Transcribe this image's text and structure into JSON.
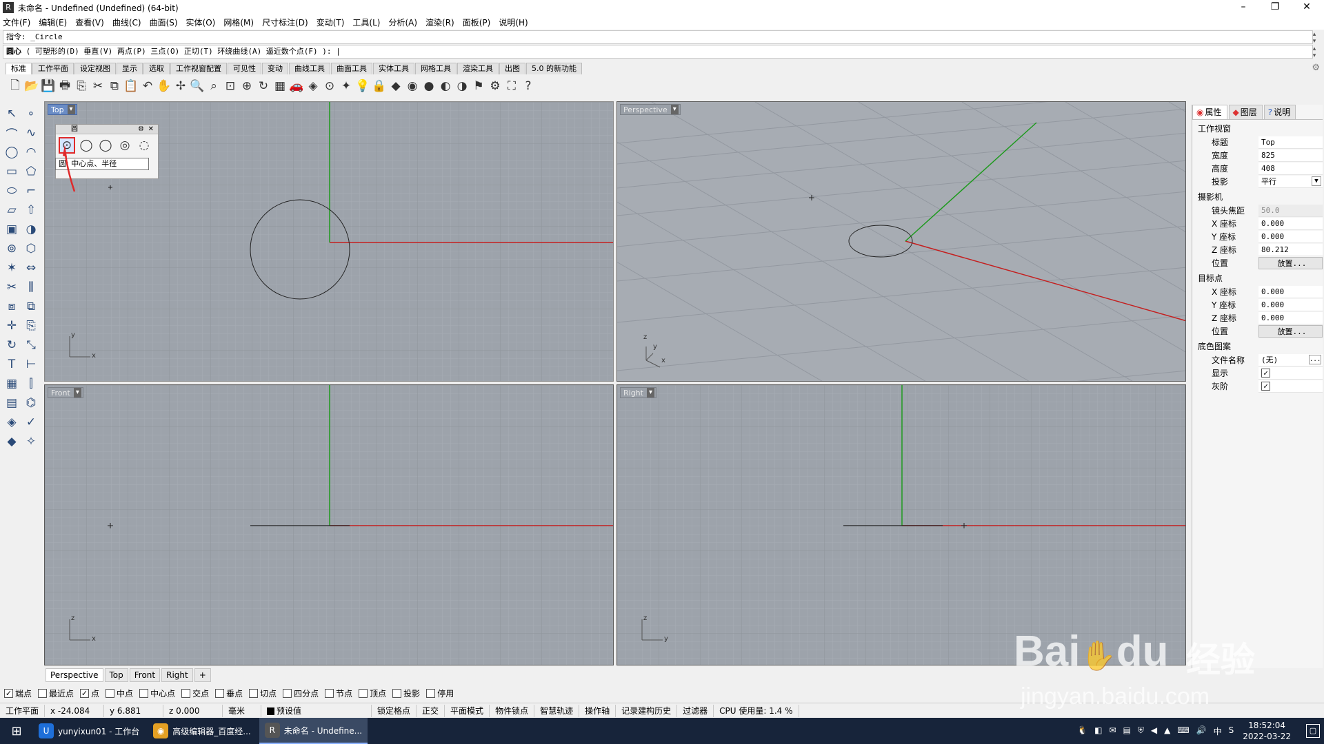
{
  "window": {
    "title": "未命名 - Undefined (Undefined) (64-bit)",
    "app_icon": "rhino-icon",
    "controls": {
      "minimize": "–",
      "maximize": "❐",
      "close": "✕"
    }
  },
  "menu": [
    "文件(F)",
    "编辑(E)",
    "查看(V)",
    "曲线(C)",
    "曲面(S)",
    "实体(O)",
    "网格(M)",
    "尺寸标注(D)",
    "变动(T)",
    "工具(L)",
    "分析(A)",
    "渲染(R)",
    "面板(P)",
    "说明(H)"
  ],
  "command": {
    "history": "指令: _Circle",
    "prompt_label": "圆心",
    "prompt_options": " ( 可塑形的(D)  垂直(V)  两点(P)  三点(O)  正切(T)  环绕曲线(A)  逼近数个点(F) ): |"
  },
  "toolbar_tabs": [
    "标准",
    "工作平面",
    "设定视图",
    "显示",
    "选取",
    "工作视窗配置",
    "可见性",
    "变动",
    "曲线工具",
    "曲面工具",
    "实体工具",
    "网格工具",
    "渲染工具",
    "出图",
    "5.0 的新功能"
  ],
  "toolbar_icons": [
    "new-icon",
    "open-icon",
    "save-icon",
    "print-icon",
    "import-icon",
    "cut-icon",
    "copy-icon",
    "paste-icon",
    "undo-icon",
    "pan-icon",
    "rotate-icon",
    "zoom-icon",
    "zoom-window-icon",
    "zoom-extents-icon",
    "zoom-selected-icon",
    "rotate-view-icon",
    "four-view-icon",
    "car-icon",
    "cplane-icon",
    "grid-snap-icon",
    "lights-icon",
    "bulb-icon",
    "lock-icon",
    "material-icon",
    "color-wheel-icon",
    "sphere-icon",
    "shaded-icon",
    "render-icon",
    "highlight-icon",
    "settings-icon",
    "options-icon",
    "help-icon"
  ],
  "toolbar_glyphs": [
    "🗋",
    "📂",
    "💾",
    "🖶",
    "⎘",
    "✂",
    "⧉",
    "📋",
    "↶",
    "✋",
    "✢",
    "🔍",
    "⌕",
    "⊡",
    "⊕",
    "↻",
    "▦",
    "🚗",
    "◈",
    "⊙",
    "✦",
    "💡",
    "🔒",
    "◆",
    "◉",
    "●",
    "◐",
    "◑",
    "⚑",
    "⚙",
    "⛶",
    "?"
  ],
  "left_tools": [
    "select-icon",
    "point-icon",
    "polyline-icon",
    "curve-icon",
    "circle-icon",
    "arc-icon",
    "rectangle-icon",
    "polygon-icon",
    "ellipse-icon",
    "fillet-icon",
    "surface-icon",
    "extrude-icon",
    "box-icon",
    "boolean-icon",
    "cylinder-icon",
    "mesh-icon",
    "explode-icon",
    "join-icon",
    "trim-icon",
    "split-icon",
    "group-icon",
    "ungroup-icon",
    "move-icon",
    "copy-tool-icon",
    "rotate-tool-icon",
    "scale-icon",
    "text-icon",
    "dimension-icon",
    "array-icon",
    "mirror-icon",
    "layout-icon",
    "analyze-icon",
    "render-tool-icon",
    "check-icon",
    "material-tool-icon",
    "light-tool-icon"
  ],
  "left_glyphs": [
    "↖",
    "∘",
    "⌒",
    "∿",
    "◯",
    "◠",
    "▭",
    "⬠",
    "⬭",
    "⌐",
    "▱",
    "⇧",
    "▣",
    "◑",
    "⊚",
    "⬡",
    "✶",
    "⇔",
    "✂",
    "⫼",
    "⧈",
    "⧉",
    "✛",
    "⎘",
    "↻",
    "⤡",
    "T",
    "⊢",
    "▦",
    "⫿",
    "▤",
    "⌬",
    "◈",
    "✓",
    "◆",
    "✧"
  ],
  "viewports": {
    "top": {
      "label": "Top",
      "active": true,
      "axis_a": "y",
      "axis_b": "x"
    },
    "perspective": {
      "label": "Perspective",
      "axis_a": "z",
      "axis_b": "y",
      "axis_c": "x"
    },
    "front": {
      "label": "Front",
      "axis_a": "z",
      "axis_b": "x"
    },
    "right": {
      "label": "Right",
      "axis_a": "z",
      "axis_b": "y"
    }
  },
  "circle_popup": {
    "title": "圆",
    "buttons": [
      "circle-center-radius-icon",
      "circle-2pt-icon",
      "circle-3pt-icon",
      "circle-tangent-icon",
      "circle-around-curve-icon"
    ],
    "tooltip": "圆: 中心点、半径"
  },
  "viewport_tabs": [
    "Perspective",
    "Top",
    "Front",
    "Right",
    "+"
  ],
  "osnap": [
    {
      "label": "端点",
      "checked": true
    },
    {
      "label": "最近点",
      "checked": false
    },
    {
      "label": "点",
      "checked": true
    },
    {
      "label": "中点",
      "checked": false
    },
    {
      "label": "中心点",
      "checked": false
    },
    {
      "label": "交点",
      "checked": false
    },
    {
      "label": "垂点",
      "checked": false
    },
    {
      "label": "切点",
      "checked": false
    },
    {
      "label": "四分点",
      "checked": false
    },
    {
      "label": "节点",
      "checked": false
    },
    {
      "label": "顶点",
      "checked": false
    },
    {
      "label": "投影",
      "checked": false
    },
    {
      "label": "停用",
      "checked": false
    }
  ],
  "status": {
    "cplane": "工作平面",
    "x": "x -24.084",
    "y": "y 6.881",
    "z": "z 0.000",
    "unit": "毫米",
    "layer": "预设值",
    "items": [
      "锁定格点",
      "正交",
      "平面模式",
      "物件锁点",
      "智慧轨迹",
      "操作轴",
      "记录建构历史",
      "过滤器"
    ],
    "cpu": "CPU 使用量: 1.4 %"
  },
  "properties": {
    "tabs": [
      "属性",
      "图层",
      "说明"
    ],
    "section_viewport": "工作视窗",
    "title_label": "标题",
    "title_value": "Top",
    "width_label": "宽度",
    "width_value": "825",
    "height_label": "高度",
    "height_value": "408",
    "projection_label": "投影",
    "projection_value": "平行",
    "section_camera": "摄影机",
    "lens_label": "镜头焦距",
    "lens_value": "50.0",
    "cam_x_label": "X 座标",
    "cam_x_value": "0.000",
    "cam_y_label": "Y 座标",
    "cam_y_value": "0.000",
    "cam_z_label": "Z 座标",
    "cam_z_value": "80.212",
    "cam_pos_label": "位置",
    "cam_pos_button": "放置...",
    "section_target": "目标点",
    "tgt_x_label": "X 座标",
    "tgt_x_value": "0.000",
    "tgt_y_label": "Y 座标",
    "tgt_y_value": "0.000",
    "tgt_z_label": "Z 座标",
    "tgt_z_value": "0.000",
    "tgt_pos_label": "位置",
    "tgt_pos_button": "放置...",
    "section_wallpaper": "底色图案",
    "file_label": "文件名称",
    "file_value": "(无)",
    "file_button": "...",
    "show_label": "显示",
    "gray_label": "灰阶"
  },
  "taskbar": {
    "tasks": [
      {
        "label": "yunyixun01 - 工作台",
        "icon": "u-icon",
        "glyph": "U",
        "color": "#1e6fd9"
      },
      {
        "label": "高级编辑器_百度经...",
        "icon": "chrome-icon",
        "glyph": "◉",
        "color": "#e4a023"
      },
      {
        "label": "未命名 - Undefine...",
        "icon": "rhino-icon",
        "glyph": "R",
        "color": "#555555"
      }
    ],
    "tray_glyphs": [
      "🐧",
      "◧",
      "✉",
      "▤",
      "⛨",
      "◀",
      "▲",
      "⌨",
      "🔊",
      "中",
      "S"
    ],
    "time": "18:52:04",
    "date": "2022-03-22"
  },
  "watermark": {
    "brand": "Bai",
    "brand2": "du",
    "cn": "经验",
    "url": "jingyan.baidu.com"
  },
  "colors": {
    "x_axis": "#c42020",
    "y_axis": "#1e9a1e",
    "viewport_bg": "#9da3ab",
    "grid": "#a9aeb5",
    "grid_major": "#8e939a"
  }
}
